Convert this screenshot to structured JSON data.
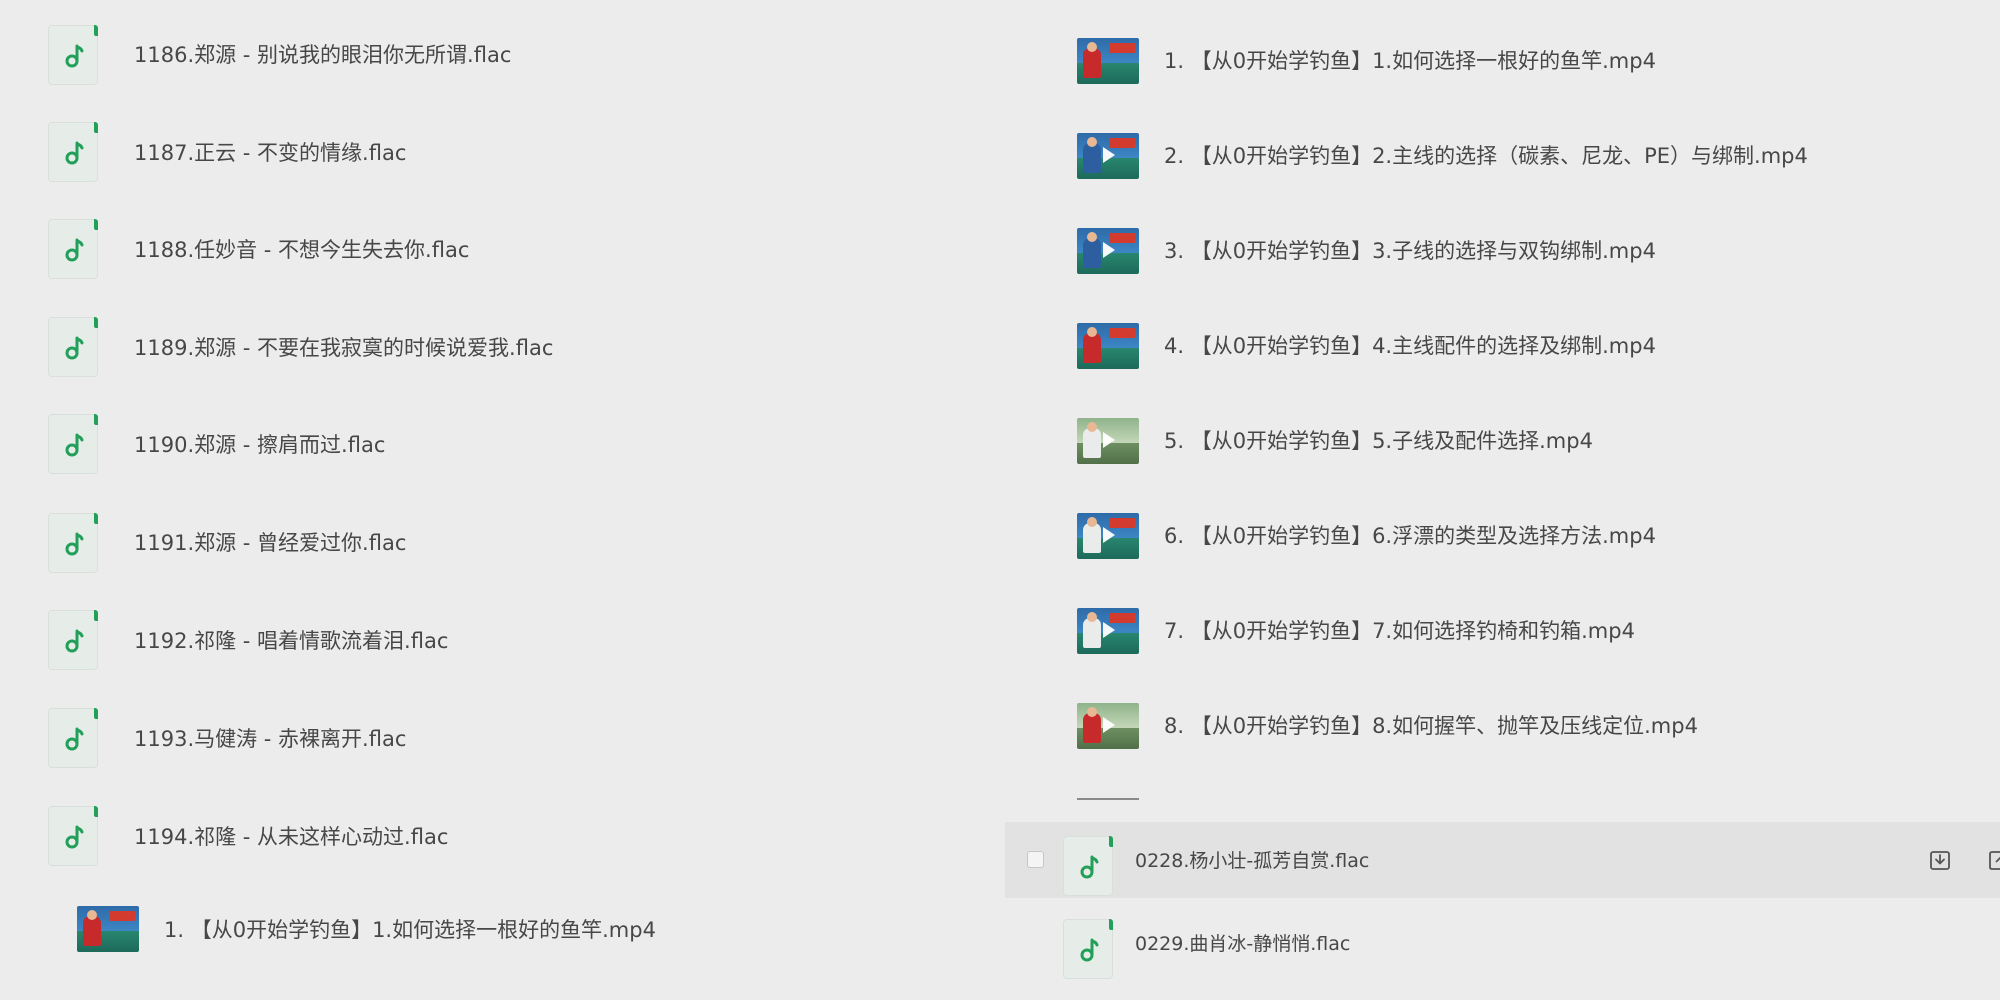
{
  "left_list": {
    "items": [
      {
        "label": "1186.郑源 - 别说我的眼泪你无所谓.flac",
        "icon": "music-note-icon"
      },
      {
        "label": "1187.正云 - 不变的情缘.flac",
        "icon": "music-note-icon"
      },
      {
        "label": "1188.任妙音 - 不想今生失去你.flac",
        "icon": "music-note-icon"
      },
      {
        "label": "1189.郑源 - 不要在我寂寞的时候说爱我.flac",
        "icon": "music-note-icon"
      },
      {
        "label": "1190.郑源 - 擦肩而过.flac",
        "icon": "music-note-icon"
      },
      {
        "label": "1191.郑源 - 曾经爱过你.flac",
        "icon": "music-note-icon"
      },
      {
        "label": "1192.祁隆 - 唱着情歌流着泪.flac",
        "icon": "music-note-icon"
      },
      {
        "label": "1193.马健涛 - 赤裸离开.flac",
        "icon": "music-note-icon"
      },
      {
        "label": "1194.祁隆 - 从未这样心动过.flac",
        "icon": "music-note-icon"
      }
    ],
    "drag_item": {
      "label": "1. 【从0开始学钓鱼】1.如何选择一根好的鱼竿.mp4",
      "icon": "video-thumbnail"
    }
  },
  "right_list": {
    "items": [
      {
        "label": "1. 【从0开始学钓鱼】1.如何选择一根好的鱼竿.mp4",
        "icon": "video-thumbnail"
      },
      {
        "label": "2. 【从0开始学钓鱼】2.主线的选择（碳素、尼龙、PE）与绑制.mp4",
        "icon": "video-thumbnail"
      },
      {
        "label": "3. 【从0开始学钓鱼】3.子线的选择与双钩绑制.mp4",
        "icon": "video-thumbnail"
      },
      {
        "label": "4. 【从0开始学钓鱼】4.主线配件的选择及绑制.mp4",
        "icon": "video-thumbnail"
      },
      {
        "label": "5. 【从0开始学钓鱼】5.子线及配件选择.mp4",
        "icon": "video-thumbnail"
      },
      {
        "label": "6. 【从0开始学钓鱼】6.浮漂的类型及选择方法.mp4",
        "icon": "video-thumbnail"
      },
      {
        "label": "7. 【从0开始学钓鱼】7.如何选择钓椅和钓箱.mp4",
        "icon": "video-thumbnail"
      },
      {
        "label": "8. 【从0开始学钓鱼】8.如何握竿、抛竿及压线定位.mp4",
        "icon": "video-thumbnail"
      }
    ]
  },
  "bottom_list": {
    "items": [
      {
        "label": "0228.杨小壮-孤芳自赏.flac",
        "icon": "music-note-icon",
        "hovered": true,
        "actions": [
          "download-icon",
          "share-icon"
        ]
      },
      {
        "label": "0229.曲肖冰-静悄悄.flac",
        "icon": "music-note-icon",
        "hovered": false
      }
    ]
  },
  "colors": {
    "background": "#ececec",
    "accent": "#22a05a",
    "hover_row": "#e2e2e2",
    "text": "#474747"
  }
}
